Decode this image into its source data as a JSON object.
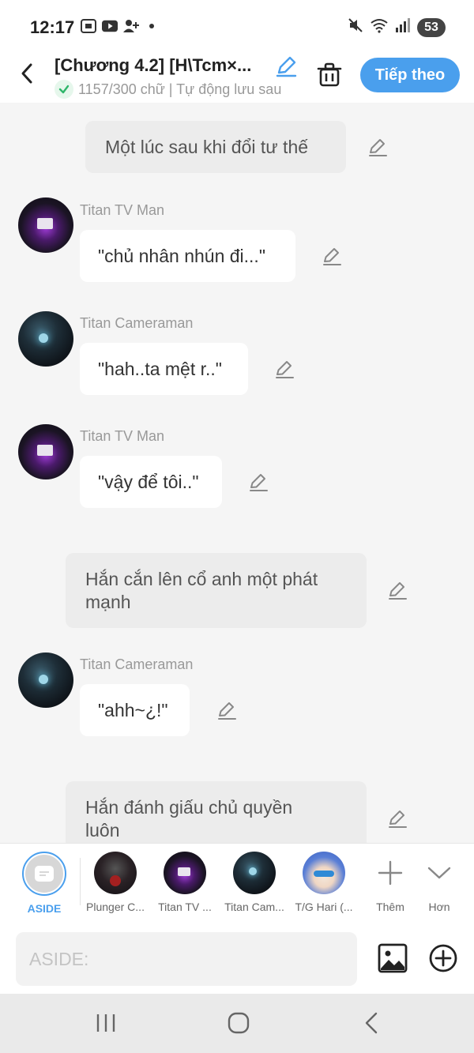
{
  "status_bar": {
    "time": "12:17",
    "battery": "53",
    "icons_left": [
      "screenshot-icon",
      "youtube-icon",
      "add-contact-icon",
      "notification-dot-icon"
    ],
    "icons_right": [
      "mute-icon",
      "wifi-icon",
      "signal-icon",
      "battery-icon"
    ]
  },
  "header": {
    "title": "[Chương 4.2] [H\\Tcm×...",
    "subtitle": "1157/300 chữ | Tự động lưu sau",
    "next_label": "Tiếp theo"
  },
  "messages": [
    {
      "type": "narration",
      "text": "Một lúc sau khi đổi tư thế"
    },
    {
      "type": "dialogue",
      "speaker": "Titan TV Man",
      "text": "\"chủ nhân nhún đi...\""
    },
    {
      "type": "dialogue",
      "speaker": "Titan Cameraman",
      "text": "\"hah..ta mệt r..\""
    },
    {
      "type": "dialogue",
      "speaker": "Titan TV Man",
      "text": "\"vậy để tôi..\""
    },
    {
      "type": "narration",
      "lines": [
        "Hắn cắn lên cổ anh một phát",
        "mạnh"
      ]
    },
    {
      "type": "dialogue",
      "speaker": "Titan Cameraman",
      "text": "\"ahh~¿!\""
    },
    {
      "type": "narration",
      "lines": [
        "Hắn đánh giấu chủ quyền",
        "luôn"
      ]
    }
  ],
  "characters": [
    {
      "name": "ASIDE",
      "active": true
    },
    {
      "name": "Plunger C..."
    },
    {
      "name": "Titan TV ..."
    },
    {
      "name": "Titan Cam..."
    },
    {
      "name": "T/G Hari (..."
    }
  ],
  "tools": {
    "add_label": "Thêm",
    "more_label": "Hơn"
  },
  "input": {
    "placeholder": "ASIDE:"
  },
  "colors": {
    "accent": "#4a9fed",
    "bubble": "#ffffff",
    "narration": "#ececec",
    "background": "#f5f5f5"
  }
}
